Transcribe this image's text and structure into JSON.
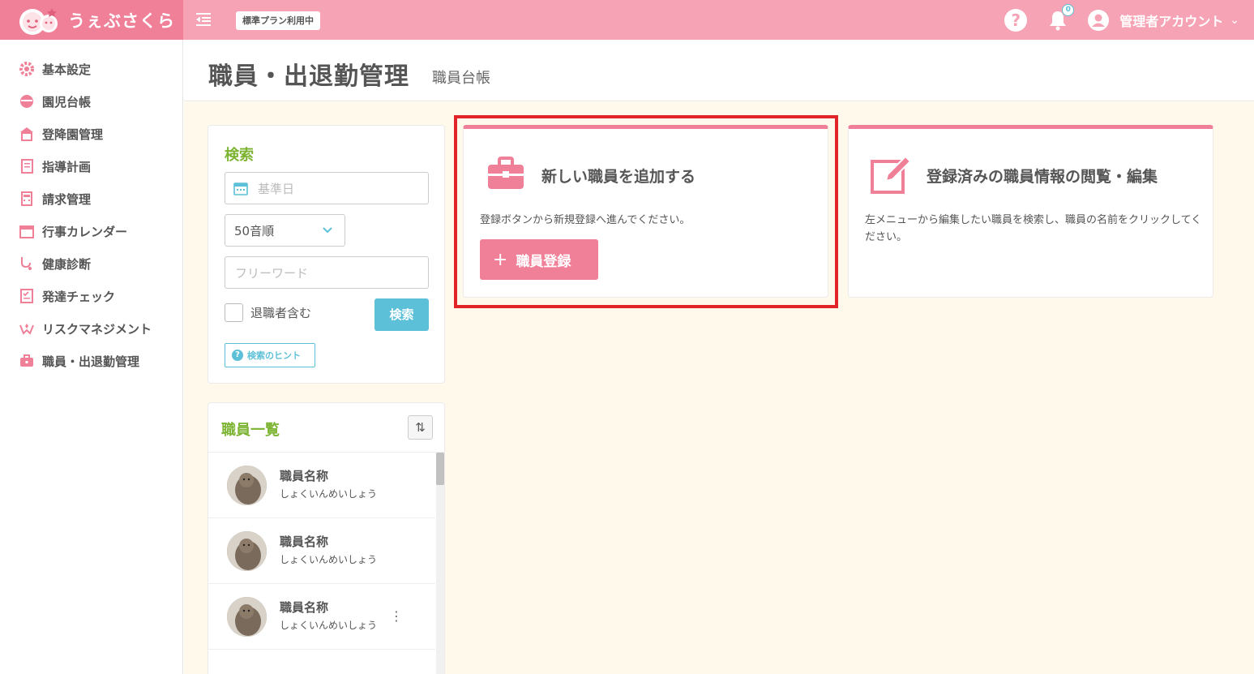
{
  "header": {
    "brand": "うぇぶさくら",
    "plan_badge": "標準プラン利用中",
    "notification_count": "0",
    "user_name": "管理者アカウント",
    "accent": "#f6a4b5",
    "brand_color": "#f07f98"
  },
  "sidebar": {
    "items": [
      {
        "label": "基本設定",
        "icon": "gear-icon"
      },
      {
        "label": "園児台帳",
        "icon": "child-icon"
      },
      {
        "label": "登降園管理",
        "icon": "school-icon"
      },
      {
        "label": "指導計画",
        "icon": "notebook-icon"
      },
      {
        "label": "請求管理",
        "icon": "calculator-icon"
      },
      {
        "label": "行事カレンダー",
        "icon": "calendar-icon"
      },
      {
        "label": "健康診断",
        "icon": "stethoscope-icon"
      },
      {
        "label": "発達チェック",
        "icon": "checklist-icon"
      },
      {
        "label": "リスクマネジメント",
        "icon": "hands-icon"
      },
      {
        "label": "職員・出退勤管理",
        "icon": "briefcase-icon"
      }
    ]
  },
  "page": {
    "title": "職員・出退勤管理",
    "subtitle": "職員台帳"
  },
  "search": {
    "heading": "検索",
    "date_placeholder": "基準日",
    "sort_value": "50音順",
    "freeword_placeholder": "フリーワード",
    "retired_label": "退職者含む",
    "search_button": "検索",
    "hint_button": "検索のヒント"
  },
  "staff_list": {
    "heading": "職員一覧",
    "rows": [
      {
        "name": "職員名称",
        "kana": "しょくいんめいしょう"
      },
      {
        "name": "職員名称",
        "kana": "しょくいんめいしょう"
      },
      {
        "name": "職員名称",
        "kana": "しょくいんめいしょう"
      }
    ]
  },
  "cards": {
    "add": {
      "title": "新しい職員を追加する",
      "desc": "登録ボタンから新規登録へ進んでください。",
      "button": "職員登録"
    },
    "edit": {
      "title": "登録済みの職員情報の閲覧・編集",
      "desc": "左メニューから編集したい職員を検索し、職員の名前をクリックしてください。"
    }
  }
}
